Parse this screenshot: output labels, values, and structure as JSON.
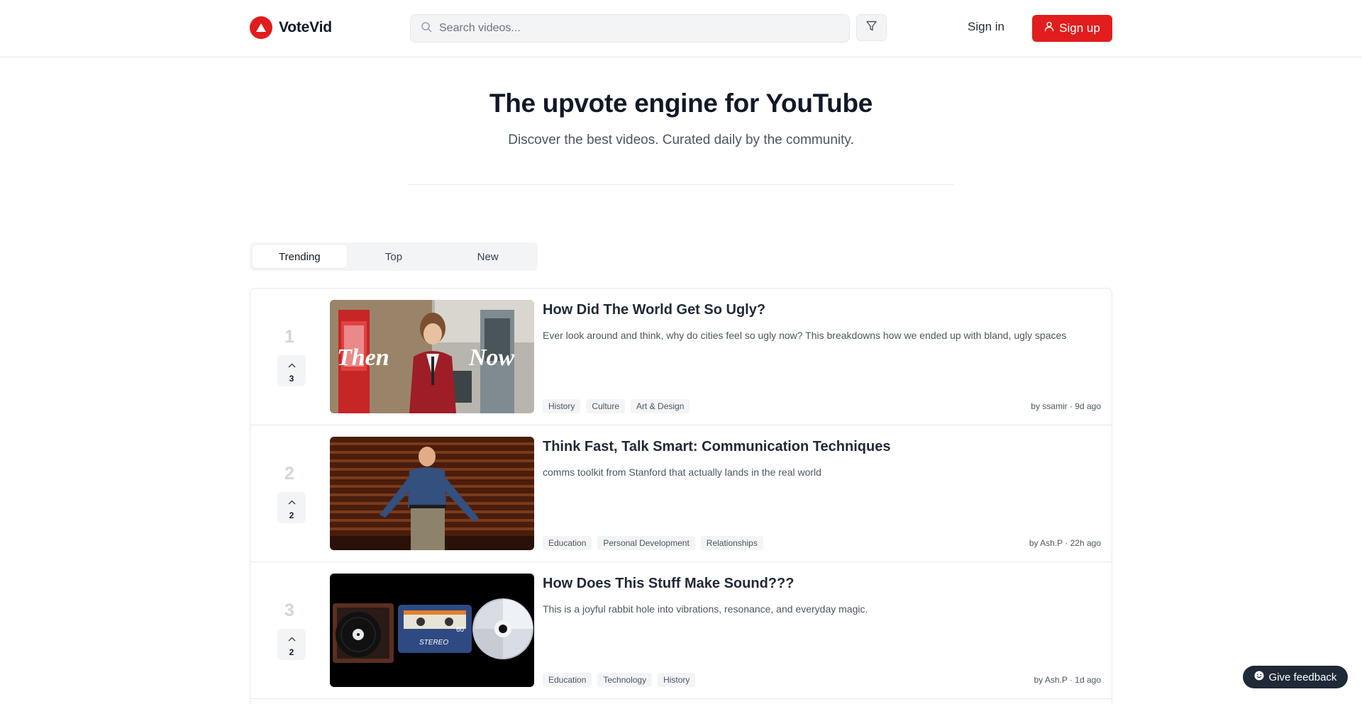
{
  "header": {
    "brand": "VoteVid",
    "search_placeholder": "Search videos...",
    "signin_label": "Sign in",
    "signup_label": "Sign up"
  },
  "hero": {
    "title": "The upvote engine for YouTube",
    "subtitle": "Discover the best videos. Curated daily by the community."
  },
  "tabs": [
    {
      "label": "Trending",
      "active": true
    },
    {
      "label": "Top",
      "active": false
    },
    {
      "label": "New",
      "active": false
    }
  ],
  "videos": [
    {
      "rank": "1",
      "votes": "3",
      "thumb_text_left": "Then",
      "thumb_text_right": "Now",
      "title": "How Did The World Get So Ugly?",
      "description": "Ever look around and think, why do cities feel so ugly now? This breakdowns how we ended up with bland, ugly spaces",
      "tags": [
        "History",
        "Culture",
        "Art & Design"
      ],
      "meta": "by ssamir · 9d ago"
    },
    {
      "rank": "2",
      "votes": "2",
      "title": "Think Fast, Talk Smart: Communication Techniques",
      "description": "comms toolkit from Stanford that actually lands in the real world",
      "tags": [
        "Education",
        "Personal Development",
        "Relationships"
      ],
      "meta": "by Ash.P · 22h ago"
    },
    {
      "rank": "3",
      "votes": "2",
      "thumb_cassette_label": "STEREO",
      "thumb_cassette_number": "60",
      "title": "How Does This Stuff Make Sound???",
      "description": "This is a joyful rabbit hole into vibrations, resonance, and everyday magic.",
      "tags": [
        "Education",
        "Technology",
        "History"
      ],
      "meta": "by Ash.P · 1d ago"
    }
  ],
  "feedback": {
    "label": "Give feedback"
  },
  "colors": {
    "brand": "#e11d1d",
    "dark": "#1f2937"
  },
  "icons": [
    "logo-triangle-icon",
    "search-icon",
    "filter-icon",
    "user-icon",
    "chevron-up-icon",
    "smile-icon"
  ]
}
